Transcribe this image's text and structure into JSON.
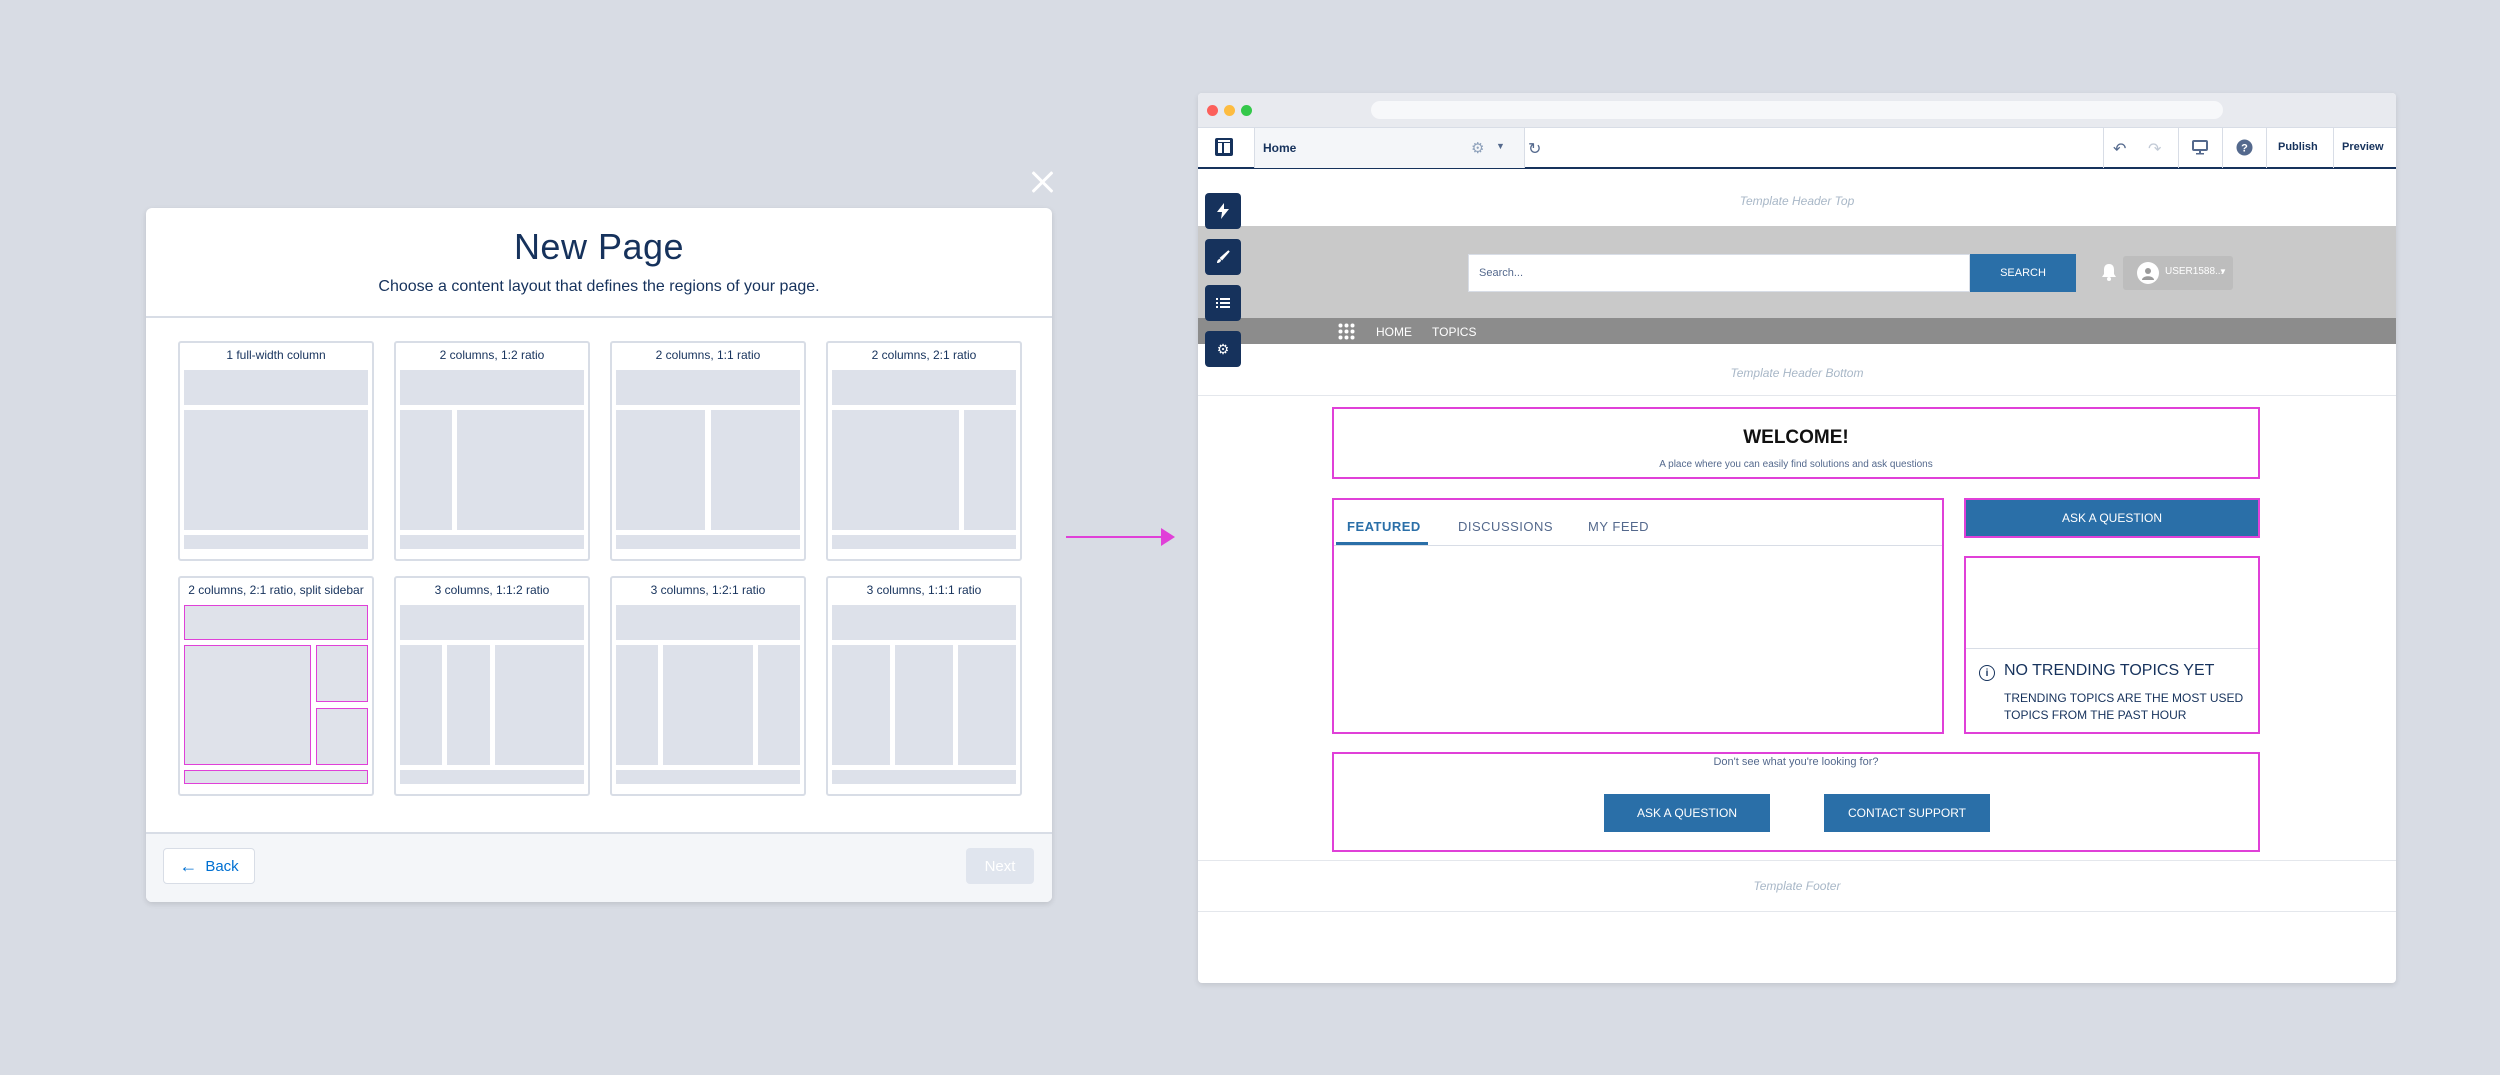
{
  "modal": {
    "title": "New Page",
    "subtitle": "Choose a content layout that defines the regions of your page.",
    "layouts": [
      "1 full-width column",
      "2 columns, 1:2 ratio",
      "2 columns, 1:1 ratio",
      "2 columns, 2:1 ratio",
      "2 columns, 2:1 ratio, split sidebar",
      "3 columns, 1:1:2 ratio",
      "3 columns, 1:2:1 ratio",
      "3 columns, 1:1:1 ratio"
    ],
    "back_label": "Back",
    "next_label": "Next"
  },
  "builder": {
    "page_name": "Home",
    "publish_label": "Publish",
    "preview_label": "Preview",
    "template_header_top": "Template Header Top",
    "template_header_bottom": "Template Header Bottom",
    "template_footer": "Template Footer",
    "search_placeholder": "Search...",
    "search_button": "SEARCH",
    "user_name": "USER1588...",
    "nav": [
      "HOME",
      "TOPICS"
    ],
    "welcome_title": "WELCOME!",
    "welcome_subtitle": "A place where you can easily find solutions and ask questions",
    "tabs": [
      "FEATURED",
      "DISCUSSIONS",
      "MY FEED"
    ],
    "ask_question": "ASK A QUESTION",
    "trending_title": "NO TRENDING TOPICS YET",
    "trending_text": "TRENDING TOPICS ARE THE MOST USED TOPICS FROM THE PAST HOUR",
    "bottom_question": "Don't see what you're looking for?",
    "contact_support": "CONTACT SUPPORT"
  },
  "colors": {
    "brand_navy": "#16325c",
    "button_blue": "#2a6fa8",
    "highlight_magenta": "#e040d8",
    "background": "#d8dce4"
  }
}
